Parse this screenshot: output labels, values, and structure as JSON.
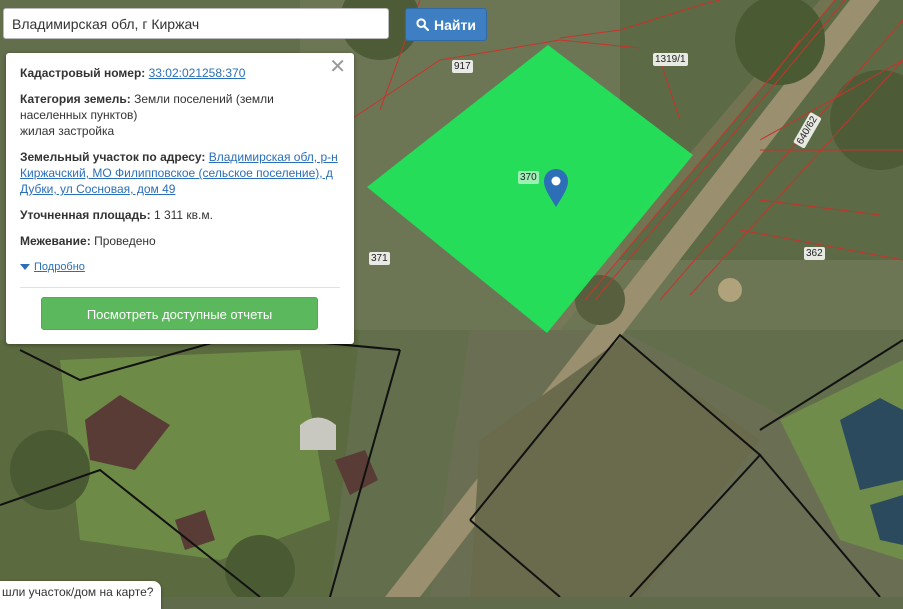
{
  "search": {
    "value": "Владимирская обл, г Киржач",
    "button_label": "Найти"
  },
  "parcel_labels": {
    "p917": "917",
    "p1319": "1319/1",
    "p370": "370",
    "p371": "371",
    "p640": "640/62",
    "p362": "362"
  },
  "info": {
    "cadastral_label": "Кадастровый номер:",
    "cadastral_number": "33:02:021258:370",
    "category_label": "Категория земель:",
    "category_value": "Земли поселений (земли населенных пунктов)",
    "usage_value": "жилая застройка",
    "address_label": "Земельный участок по адресу:",
    "address_value": "Владимирская обл, р-н Киржачский, МО Филипповское (сельское поселение), д Дубки, ул Сосновая, дом 49",
    "area_label": "Уточненная площадь:",
    "area_value": "1 311 кв.м.",
    "survey_label": "Межевание:",
    "survey_value": "Проведено",
    "details_label": "Подробно",
    "reports_button": "Посмотреть доступные отчеты"
  },
  "help_text": "шли участок/дом на карте?",
  "colors": {
    "parcel_fill": "#22e35a",
    "boundary": "#c8332b",
    "search_button": "#3d7fc2",
    "reports_button": "#5cb85c",
    "marker": "#2c6fb7"
  }
}
